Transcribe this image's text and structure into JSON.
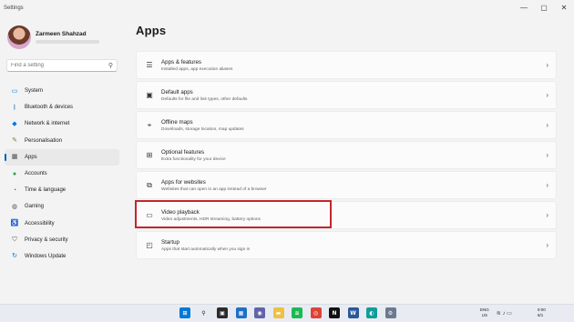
{
  "window": {
    "app_title": "Settings",
    "controls": {
      "minimize": "—",
      "maximize": "▢",
      "close": "✕"
    }
  },
  "profile": {
    "name": "Zarmeen Shahzad"
  },
  "search": {
    "placeholder": "Find a setting",
    "icon": "search-icon"
  },
  "nav": {
    "items": [
      {
        "label": "System",
        "icon": "monitor-icon",
        "color": "#0078d4"
      },
      {
        "label": "Bluetooth & devices",
        "icon": "bluetooth-icon",
        "color": "#0067c0"
      },
      {
        "label": "Network & internet",
        "icon": "wifi-icon",
        "color": "#0078d4"
      },
      {
        "label": "Personalisation",
        "icon": "brush-icon",
        "color": "#8a6d3b"
      },
      {
        "label": "Apps",
        "icon": "apps-icon",
        "color": "#4a4a4a",
        "active": true
      },
      {
        "label": "Accounts",
        "icon": "person-icon",
        "color": "#2aa04a"
      },
      {
        "label": "Time & language",
        "icon": "globe-clock-icon",
        "color": "#0078d4"
      },
      {
        "label": "Gaming",
        "icon": "gamepad-icon",
        "color": "#555555"
      },
      {
        "label": "Accessibility",
        "icon": "accessibility-icon",
        "color": "#1f6fc5"
      },
      {
        "label": "Privacy & security",
        "icon": "shield-icon",
        "color": "#5a5a5a"
      },
      {
        "label": "Windows Update",
        "icon": "update-icon",
        "color": "#0078d4"
      }
    ]
  },
  "main": {
    "title": "Apps",
    "cards": [
      {
        "title": "Apps & features",
        "subtitle": "Installed apps, app execution aliases",
        "icon": "list-icon"
      },
      {
        "title": "Default apps",
        "subtitle": "Defaults for file and link types, other defaults",
        "icon": "default-apps-icon"
      },
      {
        "title": "Offline maps",
        "subtitle": "Downloads, storage location, map updates",
        "icon": "map-icon"
      },
      {
        "title": "Optional features",
        "subtitle": "Extra functionality for your device",
        "icon": "grid-plus-icon"
      },
      {
        "title": "Apps for websites",
        "subtitle": "Websites that can open in an app instead of a browser",
        "icon": "link-window-icon"
      },
      {
        "title": "Video playback",
        "subtitle": "Video adjustments, HDR streaming, battery options",
        "icon": "video-icon",
        "highlighted": true
      },
      {
        "title": "Startup",
        "subtitle": "Apps that start automatically when you sign in",
        "icon": "startup-icon"
      }
    ],
    "chevron": "›"
  },
  "taskbar": {
    "icons": [
      {
        "name": "start-icon",
        "color": "#0078d4",
        "glyph": "⊞"
      },
      {
        "name": "search-icon",
        "color": "#e8ecf2",
        "glyph": "⚲"
      },
      {
        "name": "task-view-icon",
        "color": "#2b2b2b",
        "glyph": "▣"
      },
      {
        "name": "widgets-icon",
        "color": "#1f6fc5",
        "glyph": "▦"
      },
      {
        "name": "chat-icon",
        "color": "#6264a7",
        "glyph": "◉"
      },
      {
        "name": "file-explorer-icon",
        "color": "#f0c040",
        "glyph": "▬"
      },
      {
        "name": "spotify-icon",
        "color": "#1db954",
        "glyph": "≋"
      },
      {
        "name": "chrome-icon",
        "color": "#db4437",
        "glyph": "◎"
      },
      {
        "name": "netflix-icon",
        "color": "#111111",
        "glyph": "N"
      },
      {
        "name": "word-icon",
        "color": "#2b579a",
        "glyph": "W"
      },
      {
        "name": "edge-icon",
        "color": "#0f9d9a",
        "glyph": "◐"
      },
      {
        "name": "settings-icon",
        "color": "#6b7a8f",
        "glyph": "⚙"
      }
    ],
    "lang_top": "ENG",
    "lang_bottom": "US",
    "time": "9:00",
    "date": "8/1"
  }
}
